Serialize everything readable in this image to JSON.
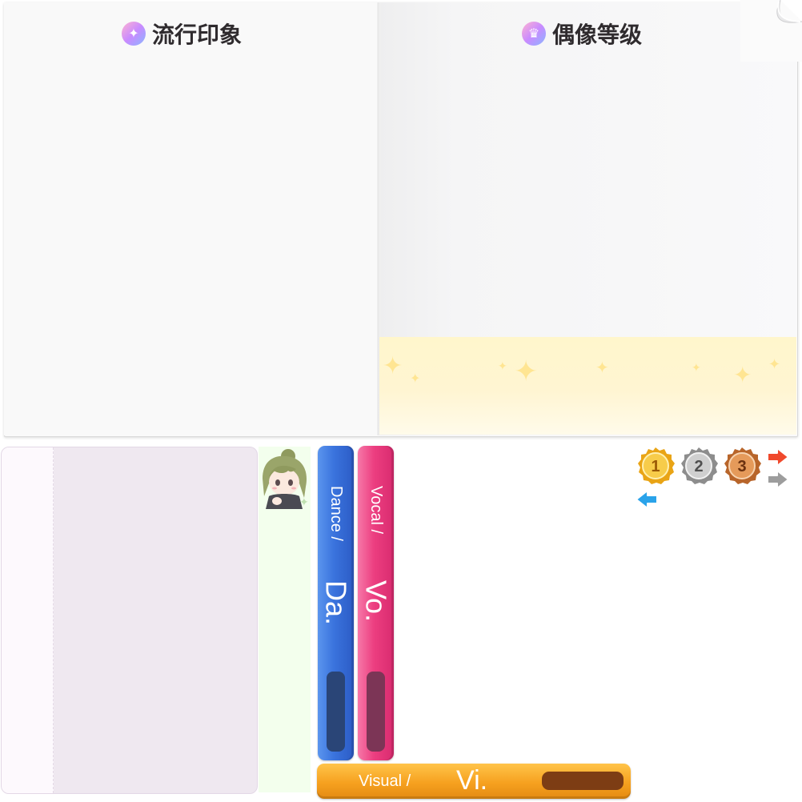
{
  "top_panel": {
    "left_title": "流行印象",
    "right_title": "偶像等级",
    "left_icon": "sparkle-icon",
    "right_icon": "crown-icon"
  },
  "stat_bars": {
    "dance": {
      "label": "Dance /",
      "abbr": "Da.",
      "color": "#3a73dd"
    },
    "vocal": {
      "label": "Vocal /",
      "abbr": "Vo.",
      "color": "#ec3e80"
    },
    "visual": {
      "label": "Visual /",
      "abbr": "Vi.",
      "color": "#f6a11f"
    }
  },
  "medals": [
    {
      "rank": "1",
      "color": "#f2b21c"
    },
    {
      "rank": "2",
      "color": "#9a9a9a"
    },
    {
      "rank": "3",
      "color": "#c9783a"
    }
  ],
  "arrows": [
    "arrow-right-red-icon",
    "arrow-right-gray-icon",
    "arrow-left-blue-icon"
  ]
}
